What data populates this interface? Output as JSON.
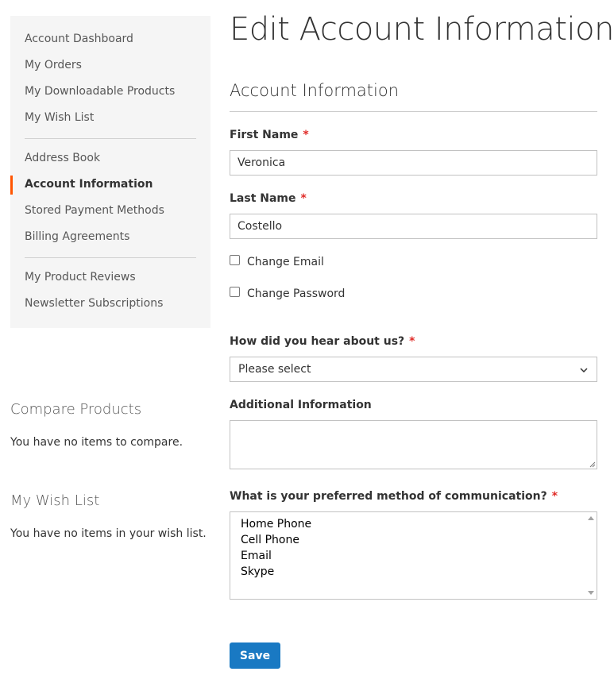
{
  "sidebar": {
    "group1": [
      {
        "label": "Account Dashboard"
      },
      {
        "label": "My Orders"
      },
      {
        "label": "My Downloadable Products"
      },
      {
        "label": "My Wish List"
      }
    ],
    "group2": [
      {
        "label": "Address Book"
      },
      {
        "label": "Account Information",
        "active": true
      },
      {
        "label": "Stored Payment Methods"
      },
      {
        "label": "Billing Agreements"
      }
    ],
    "group3": [
      {
        "label": "My Product Reviews"
      },
      {
        "label": "Newsletter Subscriptions"
      }
    ],
    "accent_color": "#ff5501"
  },
  "compare_block": {
    "title": "Compare Products",
    "empty_text": "You have no items to compare."
  },
  "wishlist_block": {
    "title": "My Wish List",
    "empty_text": "You have no items in your wish list."
  },
  "page": {
    "title": "Edit Account Information",
    "section_title": "Account Information"
  },
  "form": {
    "required_marker": "*",
    "first_name": {
      "label": "First Name",
      "value": "Veronica"
    },
    "last_name": {
      "label": "Last Name",
      "value": "Costello"
    },
    "change_email": {
      "label": "Change Email",
      "checked": false
    },
    "change_password": {
      "label": "Change Password",
      "checked": false
    },
    "hear_about": {
      "label": "How did you hear about us?",
      "selected": "Please select"
    },
    "additional_info": {
      "label": "Additional Information",
      "value": ""
    },
    "communication": {
      "label": "What is your preferred method of communication?",
      "options": [
        "Home Phone",
        "Cell Phone",
        "Email",
        "Skype"
      ]
    },
    "save_label": "Save",
    "button_color": "#1979c3"
  }
}
